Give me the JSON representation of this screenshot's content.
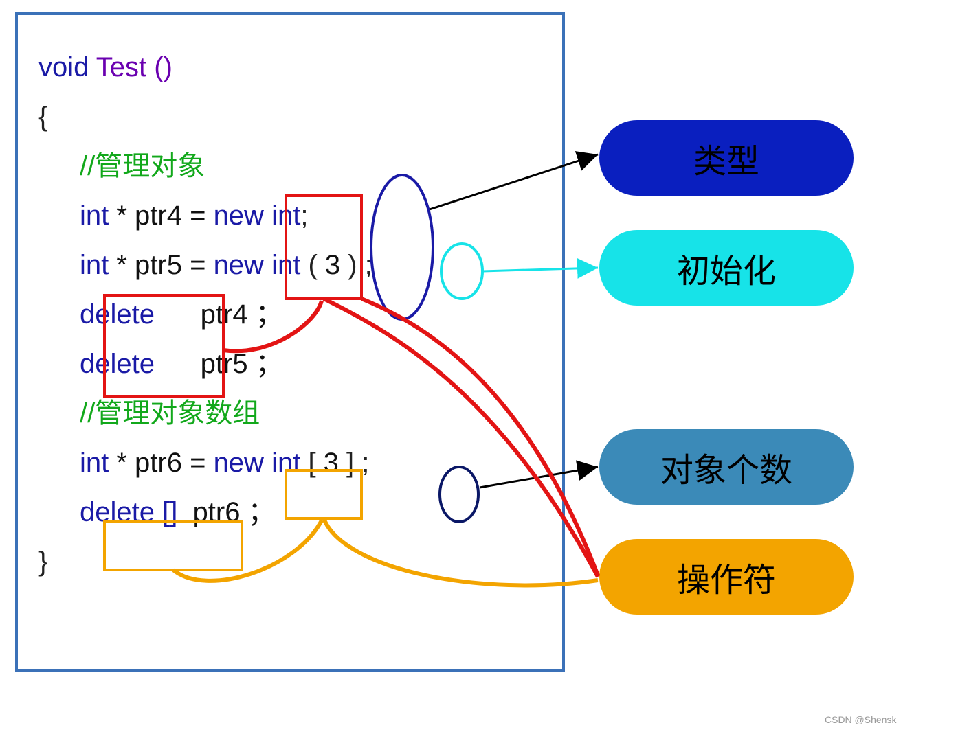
{
  "code": {
    "sig_void": "void",
    "sig_name": " Test ()",
    "brace_open": "{",
    "comment1": "//管理对象",
    "l_ptr4_a": "int",
    "l_ptr4_b": " * ptr4 = ",
    "l_ptr4_new": "new",
    "l_ptr4_c": " ",
    "l_ptr4_int": "int",
    "l_ptr4_semi": ";",
    "l_ptr5_a": "int",
    "l_ptr5_b": " * ptr5 = ",
    "l_ptr5_new": "new",
    "l_ptr5_c": " ",
    "l_ptr5_int": "int",
    "l_ptr5_d": " ( ",
    "l_ptr5_num": "3",
    "l_ptr5_e": " ) ; ",
    "l_del4_kw": "delete",
    "l_del4_rest": "      ptr4 ；",
    "l_del5_kw": "delete",
    "l_del5_rest": "      ptr5 ；",
    "comment2": "//管理对象数组",
    "l_ptr6_a": "int",
    "l_ptr6_b": " * ptr6 = ",
    "l_ptr6_new": "new",
    "l_ptr6_c": " ",
    "l_ptr6_int": "int",
    "l_ptr6_d": " [ ",
    "l_ptr6_num": "3",
    "l_ptr6_e": " ] ;",
    "l_del6_kw": "delete []",
    "l_del6_rest": "  ptr6 ；",
    "brace_close": "}"
  },
  "callouts": {
    "type": "类型",
    "init": "初始化",
    "count": "对象个数",
    "op": "操作符"
  },
  "watermark": "CSDN @Shensk"
}
